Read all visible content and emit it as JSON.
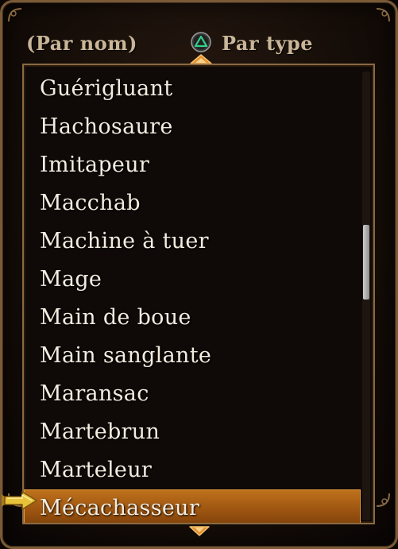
{
  "sort": {
    "by_name_label": "(Par nom)",
    "by_type_label": "Par type",
    "button_icon": "triangle-icon"
  },
  "list": {
    "items": [
      {
        "label": "Guérigluant"
      },
      {
        "label": "Hachosaure"
      },
      {
        "label": "Imitapeur"
      },
      {
        "label": "Macchab"
      },
      {
        "label": "Machine à tuer"
      },
      {
        "label": "Mage"
      },
      {
        "label": "Main de boue"
      },
      {
        "label": "Main sanglante"
      },
      {
        "label": "Maransac"
      },
      {
        "label": "Martebrun"
      },
      {
        "label": "Marteleur"
      },
      {
        "label": "Mécachasseur"
      }
    ],
    "selected_index": 11
  },
  "scrollbar": {
    "position_fraction": 0.41
  },
  "colors": {
    "frame": "#7a5a37",
    "text": "#f3ece0",
    "header_text": "#c9b698",
    "highlight": "#b0651a",
    "pointer": "#e8c23a"
  }
}
